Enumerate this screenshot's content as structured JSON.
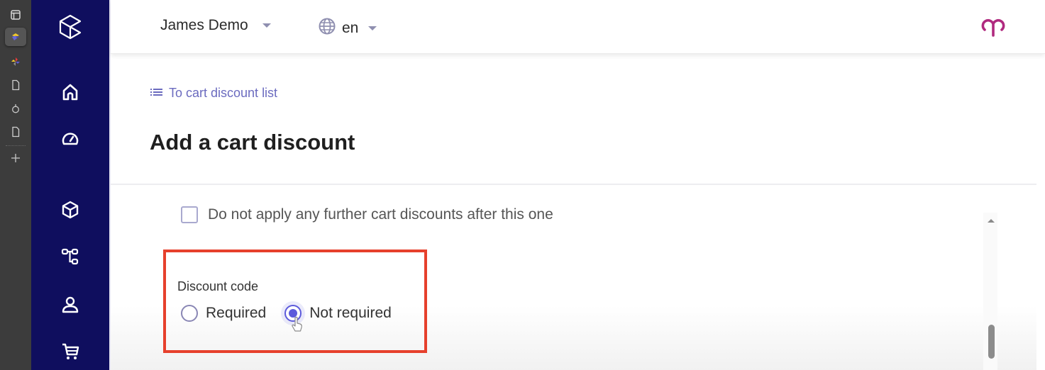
{
  "dock": {
    "items": [
      {
        "icon": "sidebar-panel-icon"
      },
      {
        "icon": "layers-app-icon",
        "active": true
      },
      {
        "icon": "pinwheel-app-icon"
      },
      {
        "icon": "document-icon"
      },
      {
        "icon": "timer-icon"
      },
      {
        "icon": "document-icon"
      },
      {
        "icon": "add-icon"
      }
    ]
  },
  "rail": {
    "logo_icon": "cube-logo-icon",
    "items": [
      {
        "id": "home",
        "icon": "home-icon"
      },
      {
        "id": "dashboard",
        "icon": "gauge-icon"
      },
      {
        "id": "products",
        "icon": "box-icon"
      },
      {
        "id": "categories",
        "icon": "hierarchy-icon"
      },
      {
        "id": "customers",
        "icon": "user-icon"
      },
      {
        "id": "orders",
        "icon": "cart-icon"
      }
    ],
    "colors": {
      "background": "#0f0e5e",
      "icon": "#ffffff"
    }
  },
  "header": {
    "project_name": "James Demo",
    "language": "en",
    "avatar_icon": "brand-avatar-icon",
    "colors": {
      "avatar": "#b02a7f"
    }
  },
  "page": {
    "back_link": "To cart discount list",
    "title": "Add a cart discount",
    "colors": {
      "link": "#6b6bbf",
      "accent": "#5c5adb",
      "highlight": "#e6402c"
    }
  },
  "form": {
    "stop_checkbox": {
      "label": "Do not apply any further cart discounts after this one",
      "checked": false
    },
    "discount_code": {
      "label": "Discount code",
      "options": [
        {
          "label": "Required",
          "checked": false
        },
        {
          "label": "Not required",
          "checked": true
        }
      ]
    }
  }
}
